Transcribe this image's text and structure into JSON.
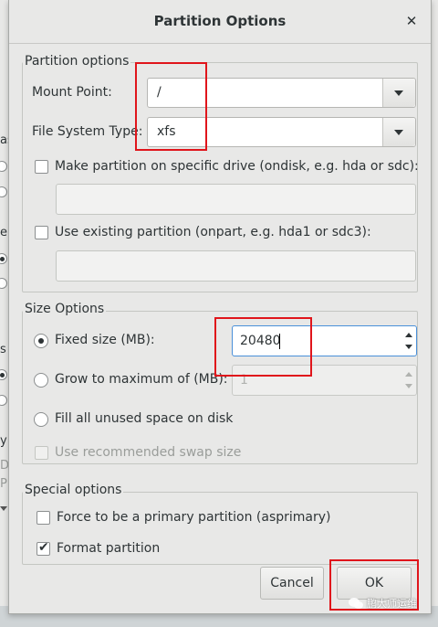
{
  "dialog": {
    "title": "Partition Options"
  },
  "partition_options": {
    "title": "Partition options",
    "mount_point_label": "Mount Point:",
    "mount_point_value": "/",
    "fs_type_label": "File System Type:",
    "fs_type_value": "xfs",
    "ondisk_label": "Make partition on specific drive (ondisk, e.g. hda or sdc):",
    "ondisk_checked": false,
    "ondisk_value": "",
    "onpart_label": "Use existing partition (onpart, e.g. hda1 or sdc3):",
    "onpart_checked": false,
    "onpart_value": ""
  },
  "size_options": {
    "title": "Size Options",
    "fixed_label": "Fixed size (MB):",
    "fixed_value": "20480",
    "grow_label": "Grow to maximum of (MB):",
    "grow_value": "1",
    "fill_label": "Fill all unused space on disk",
    "swap_label": "Use recommended swap size",
    "selected": "fixed"
  },
  "special_options": {
    "title": "Special options",
    "primary_label": "Force to be a primary partition (asprimary)",
    "primary_checked": false,
    "format_label": "Format partition",
    "format_checked": true
  },
  "buttons": {
    "cancel": "Cancel",
    "ok": "OK"
  },
  "background_window": {
    "fragments": [
      "as",
      "er",
      "s",
      "y",
      "D",
      "P"
    ]
  },
  "watermark": "鹏大师运维",
  "colors": {
    "highlight": "#e0151b",
    "focus": "#4a90d9"
  }
}
